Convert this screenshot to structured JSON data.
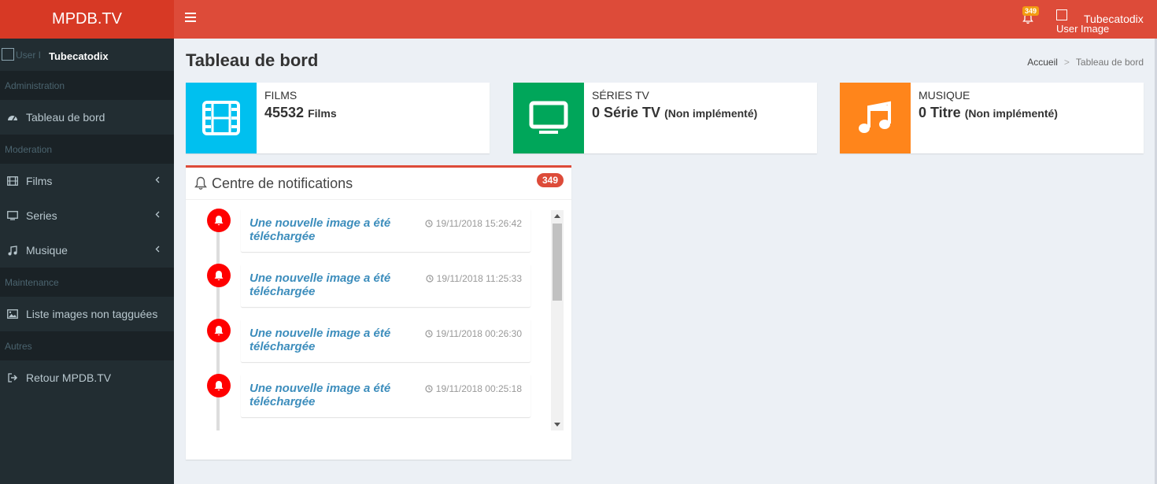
{
  "brand": "MPDB.TV",
  "header": {
    "notification_count": "349",
    "user_image_alt": "User Image",
    "user_name": "Tubecatodix"
  },
  "sidebar": {
    "user_image_alt": "User I",
    "user_name": "Tubecatodix",
    "sections": [
      {
        "header": "Administration",
        "items": [
          {
            "label": "Tableau de bord",
            "icon": "dashboard-icon"
          }
        ]
      },
      {
        "header": "Moderation",
        "items": [
          {
            "label": "Films",
            "icon": "film-icon",
            "expandable": true
          },
          {
            "label": "Series",
            "icon": "tv-icon",
            "expandable": true
          },
          {
            "label": "Musique",
            "icon": "music-icon",
            "expandable": true
          }
        ]
      },
      {
        "header": "Maintenance",
        "items": [
          {
            "label": "Liste images non tagguées",
            "icon": "image-icon"
          }
        ]
      },
      {
        "header": "Autres",
        "items": [
          {
            "label": "Retour MPDB.TV",
            "icon": "sign-out-icon"
          }
        ]
      }
    ]
  },
  "page": {
    "title": "Tableau de bord",
    "breadcrumb": [
      "Accueil",
      "Tableau de bord"
    ]
  },
  "info_boxes": [
    {
      "label": "FILMS",
      "number": "45532",
      "unit": "Films",
      "color": "#00c0ef",
      "icon": "film-icon"
    },
    {
      "label": "SÉRIES TV",
      "number": "0 Série TV",
      "unit": "(Non implémenté)",
      "color": "#00a65a",
      "icon": "tv-icon"
    },
    {
      "label": "MUSIQUE",
      "number": "0 Titre",
      "unit": "(Non implémenté)",
      "color": "#ff851b",
      "icon": "music-icon"
    }
  ],
  "notifications": {
    "title": "Centre de notifications",
    "count": "349",
    "items": [
      {
        "message": "Une nouvelle image a été téléchargée",
        "time": "19/11/2018 15:26:42"
      },
      {
        "message": "Une nouvelle image a été téléchargée",
        "time": "19/11/2018 11:25:33"
      },
      {
        "message": "Une nouvelle image a été téléchargée",
        "time": "19/11/2018 00:26:30"
      },
      {
        "message": "Une nouvelle image a été téléchargée",
        "time": "19/11/2018 00:25:18"
      }
    ]
  },
  "colors": {
    "header": "#dd4b39",
    "logo": "#d73925",
    "sidebar": "#222d32",
    "accent_link": "#3c8dbc",
    "alert": "#ff0000"
  }
}
